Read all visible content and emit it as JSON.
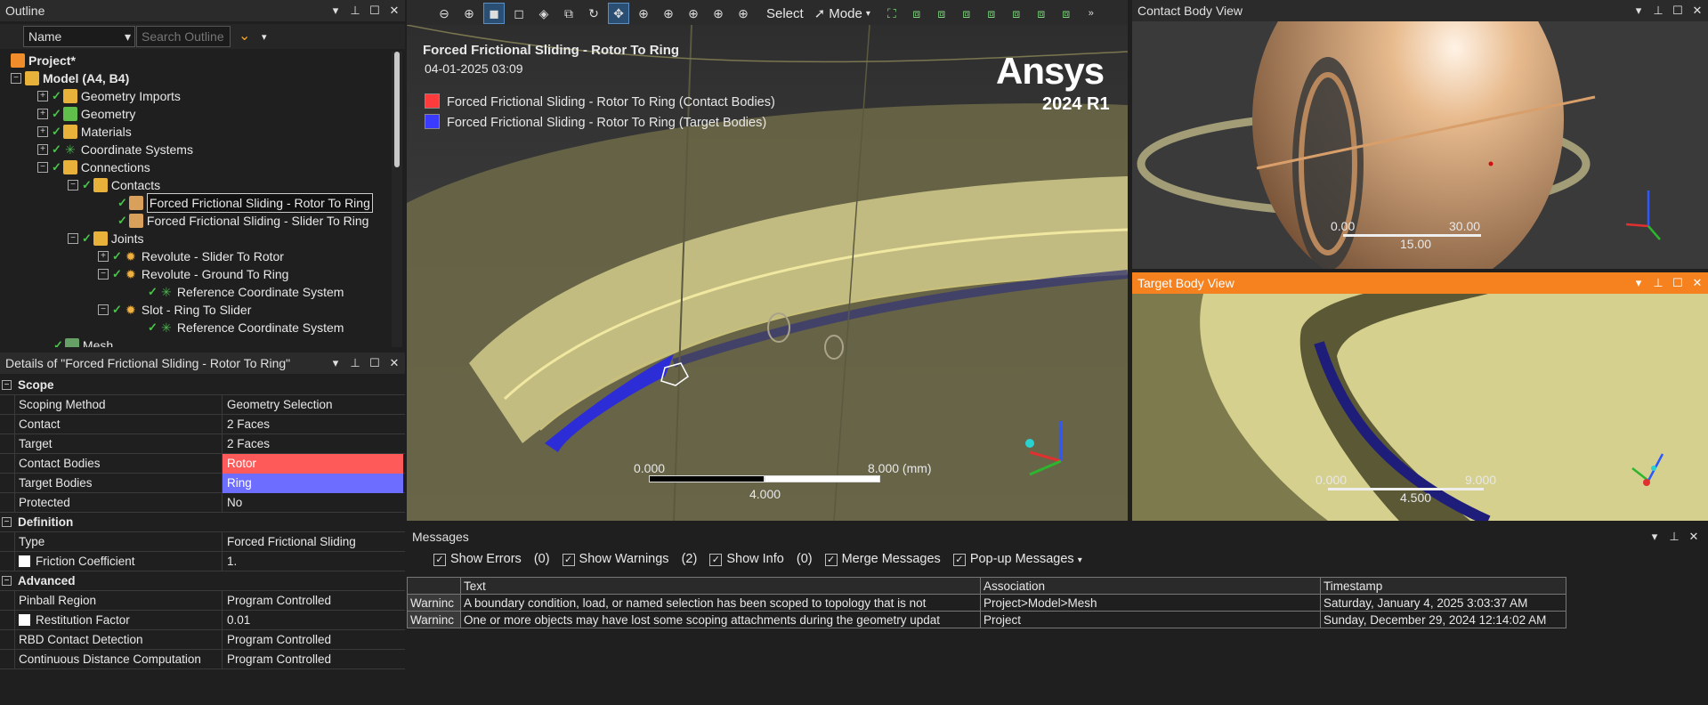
{
  "outline": {
    "title": "Outline",
    "filter_select": "Name",
    "search_placeholder": "Search Outline",
    "tree": [
      {
        "label": "Project*"
      },
      {
        "label": "Model (A4, B4)"
      },
      {
        "label": "Geometry Imports"
      },
      {
        "label": "Geometry"
      },
      {
        "label": "Materials"
      },
      {
        "label": "Coordinate Systems"
      },
      {
        "label": "Connections"
      },
      {
        "label": "Contacts"
      },
      {
        "label": "Forced Frictional Sliding - Rotor To Ring"
      },
      {
        "label": "Forced Frictional Sliding - Slider To Ring"
      },
      {
        "label": "Joints"
      },
      {
        "label": "Revolute - Slider To Rotor"
      },
      {
        "label": "Revolute - Ground To Ring"
      },
      {
        "label": "Reference Coordinate System"
      },
      {
        "label": "Slot - Ring To Slider"
      },
      {
        "label": "Reference Coordinate System"
      },
      {
        "label": "Mesh"
      }
    ]
  },
  "details": {
    "title": "Details of \"Forced Frictional Sliding - Rotor To Ring\"",
    "rows": [
      {
        "section": "Scope"
      },
      {
        "name": "Scoping Method",
        "value": "Geometry Selection"
      },
      {
        "name": "Contact",
        "value": "2 Faces"
      },
      {
        "name": "Target",
        "value": "2 Faces"
      },
      {
        "name": "Contact Bodies",
        "value": "Rotor"
      },
      {
        "name": "Target Bodies",
        "value": "Ring"
      },
      {
        "name": "Protected",
        "value": "No"
      },
      {
        "section": "Definition"
      },
      {
        "name": "Type",
        "value": "Forced Frictional Sliding"
      },
      {
        "name": "Friction Coefficient",
        "value": "1."
      },
      {
        "section": "Advanced"
      },
      {
        "name": "Pinball Region",
        "value": "Program Controlled"
      },
      {
        "name": "Restitution Factor",
        "value": "0.01"
      },
      {
        "name": "RBD Contact Detection",
        "value": "Program Controlled"
      },
      {
        "name": "Continuous Distance Computation",
        "value": "Program Controlled"
      }
    ],
    "colors": {
      "contact": "#ff5a5a",
      "target": "#6d6dff"
    }
  },
  "toolbar": {
    "select_label": "Select",
    "mode_label": "Mode"
  },
  "viewport": {
    "title": "Forced Frictional Sliding - Rotor To Ring",
    "date": "04-01-2025 03:09",
    "legend": [
      {
        "label": "Forced Frictional Sliding - Rotor To Ring (Contact Bodies)",
        "color": "#ff3b3b"
      },
      {
        "label": "Forced Frictional Sliding - Rotor To Ring (Target Bodies)",
        "color": "#3b3bff"
      }
    ],
    "brand": "Ansys",
    "version": "2024 R1",
    "scale": {
      "left": "0.000",
      "right": "8.000 (mm)",
      "mid": "4.000"
    }
  },
  "contact_view": {
    "title": "Contact Body View",
    "scale": {
      "left": "0.00",
      "right": "30.00",
      "mid": "15.00"
    }
  },
  "target_view": {
    "title": "Target Body View",
    "scale": {
      "left": "0.000",
      "right": "9.000",
      "mid": "4.500"
    }
  },
  "messages": {
    "title": "Messages",
    "options": [
      {
        "label": "Show Errors",
        "count": "(0)"
      },
      {
        "label": "Show Warnings",
        "count": "(2)"
      },
      {
        "label": "Show Info",
        "count": "(0)"
      },
      {
        "label": "Merge Messages",
        "count": ""
      },
      {
        "label": "Pop-up Messages",
        "count": ""
      }
    ],
    "columns": [
      "",
      "Text",
      "Association",
      "Timestamp"
    ],
    "rows": [
      {
        "type": "Warninc",
        "text": "A boundary condition, load, or named selection has been scoped to topology that is not",
        "assoc": "Project>Model>Mesh",
        "time": "Saturday, January 4, 2025 3:03:37 AM"
      },
      {
        "type": "Warninc",
        "text": "One or more objects may have lost some scoping attachments during the geometry updat",
        "assoc": "Project",
        "time": "Sunday, December 29, 2024 12:14:02 AM"
      }
    ]
  }
}
